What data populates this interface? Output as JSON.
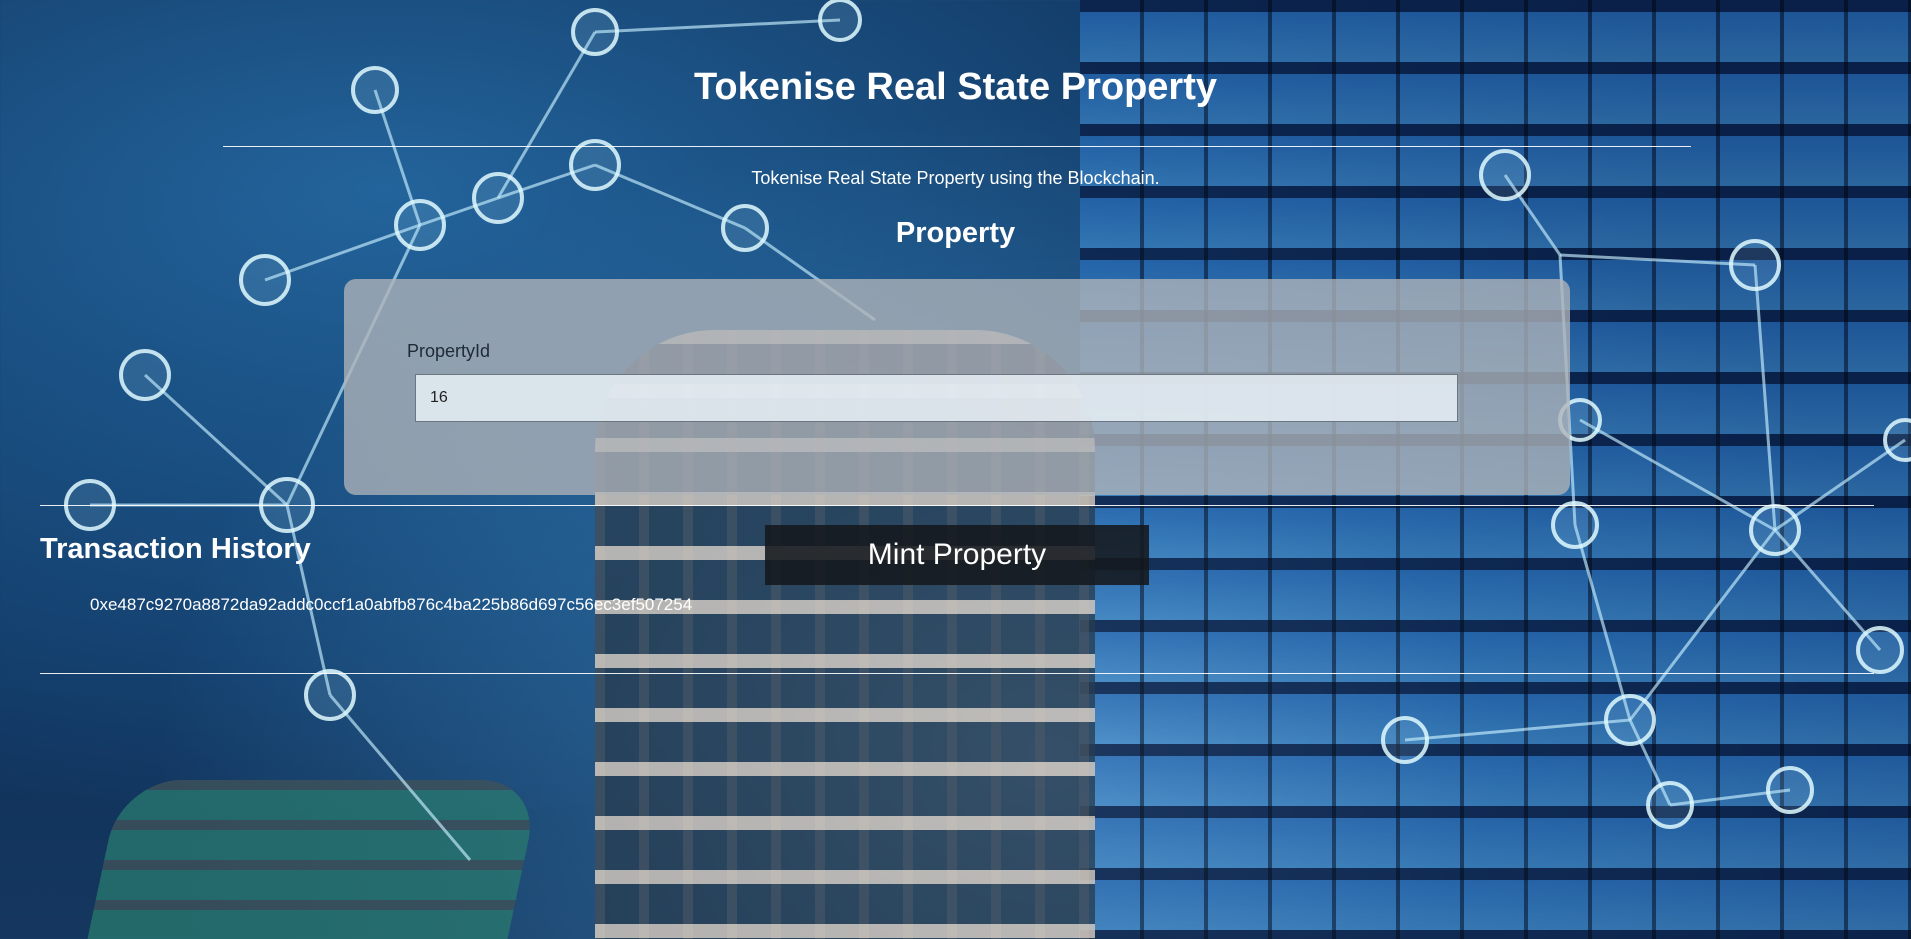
{
  "header": {
    "title": "Tokenise Real State Property",
    "subtitle": "Tokenise Real State Property using the Blockchain."
  },
  "property_section": {
    "title": "Property",
    "field_label": "PropertyId",
    "field_value": "16"
  },
  "actions": {
    "mint_label": "Mint Property"
  },
  "history": {
    "title": "Transaction History",
    "items": [
      "0xe487c9270a8872da92addc0ccf1a0abfb876c4ba225b86d697c56ec3ef507254"
    ]
  },
  "colors": {
    "text": "#ffffff",
    "card_bg": "#afb4b9",
    "button_bg": "#14181c"
  }
}
